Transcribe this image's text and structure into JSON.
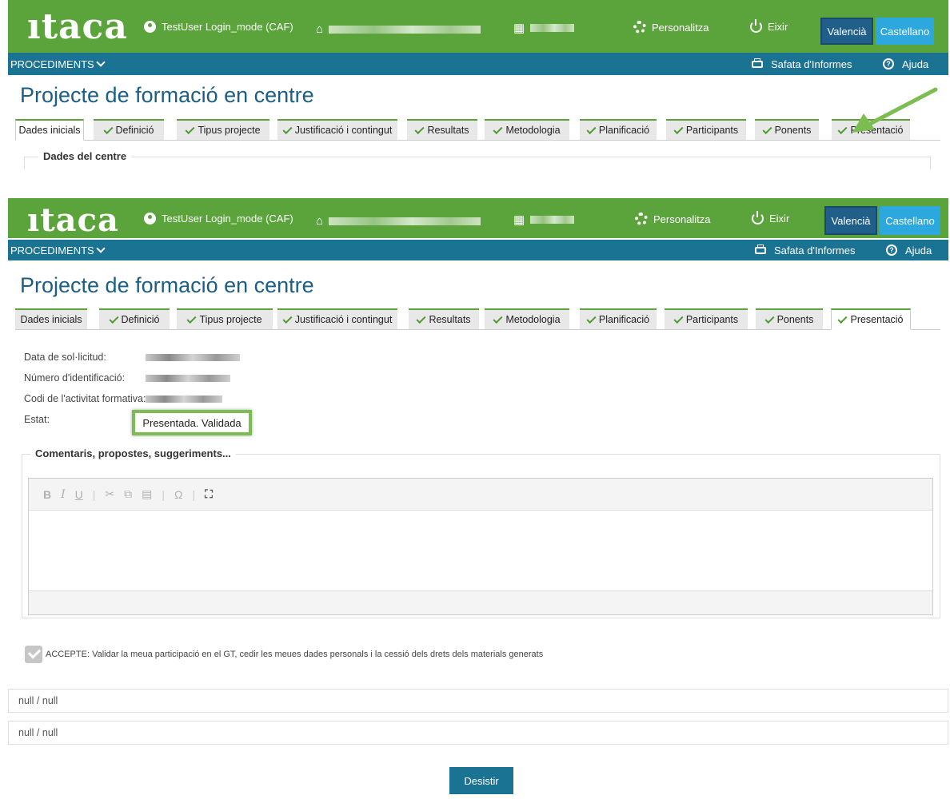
{
  "header": {
    "logo": "ıtaca",
    "user": "TestUser Login_mode (CAF)",
    "personalitza": "Personalitza",
    "exit": "Eixir",
    "lang_valencia": "Valencià",
    "lang_castellano": "Castellano"
  },
  "nav": {
    "procediments": "PROCEDIMENTS",
    "reports": "Safata d'Informes",
    "help": "Ajuda"
  },
  "page_title": "Projecte de formació en centre",
  "tabs": [
    {
      "label": "Dades inicials",
      "checked": false
    },
    {
      "label": "Definició",
      "checked": true
    },
    {
      "label": "Tipus projecte",
      "checked": true
    },
    {
      "label": "Justificació i contingut",
      "checked": true
    },
    {
      "label": "Resultats",
      "checked": true
    },
    {
      "label": "Metodologia",
      "checked": true
    },
    {
      "label": "Planificació",
      "checked": true
    },
    {
      "label": "Participants",
      "checked": true
    },
    {
      "label": "Ponents",
      "checked": true
    },
    {
      "label": "Presentació",
      "checked": true
    }
  ],
  "panel1": {
    "active_tab": "Dades inicials",
    "section_title": "Dades del centre"
  },
  "panel2": {
    "active_tab": "Presentació",
    "fields": {
      "data_label": "Data de sol·licitud:",
      "numero_label": "Número d'identificació:",
      "codi_label": "Codi de l'activitat formativa:",
      "estat_label": "Estat:",
      "estat_value": "Presentada. Validada"
    },
    "comments_title": "Comentaris, propostes, suggeriments...",
    "editor_toolbar": {
      "bold": "B",
      "italic": "I",
      "underline": "U",
      "cut": "✂",
      "copy": "⧉",
      "paste": "▤",
      "special_char": "Ω",
      "maximize": "⛶"
    },
    "accept_text": "ACCEPTE: Validar la meua participació en el GT, cedir les meues dades personals i la cessió dels drets dels materials generats",
    "null_1": "null / null",
    "null_2": "null / null",
    "desistir": "Desistir"
  },
  "colors": {
    "green": "#5ba43b",
    "blue_nav": "#1b7394",
    "title_blue": "#1b5f86",
    "highlight_green": "#7cbd52"
  }
}
